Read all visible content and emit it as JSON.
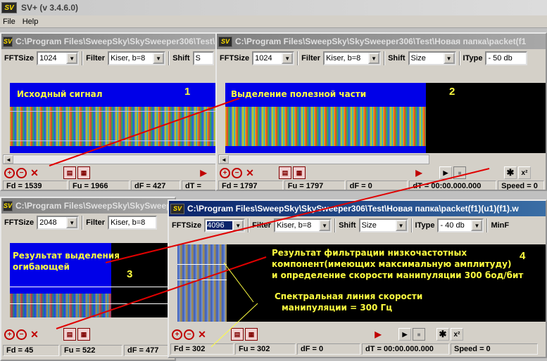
{
  "app": {
    "title": "SV+  (v 3.4.6.0)",
    "logo": "SV"
  },
  "menu": [
    "File",
    "Help"
  ],
  "windows": [
    {
      "title": "C:\\Program Files\\SweepSky\\SkySweeper306\\Test\\Новая папка\\packet(f1)",
      "fftsize_label": "FFTSize",
      "fftsize": "1024",
      "filter_label": "Filter",
      "filter": "Kiser, b=8",
      "shift_label": "Shift",
      "shift": "S",
      "annotation": "Исходный сигнал",
      "number": "1",
      "status": [
        "Fd = 1539",
        "Fu = 1966",
        "dF = 427",
        "dT ="
      ]
    },
    {
      "title": "C:\\Program Files\\SweepSky\\SkySweeper306\\Test\\Новая папка\\packet(f1",
      "fftsize_label": "FFTSize",
      "fftsize": "1024",
      "filter_label": "Filter",
      "filter": "Kiser, b=8",
      "shift_label": "Shift",
      "shift": "Size",
      "itype_label": "IType",
      "itype": "- 50 db",
      "annotation": "Выделение полезной части",
      "number": "2",
      "status": [
        "Fd = 1797",
        "Fu = 1797",
        "dF = 0",
        "dT = 00:00.000.000",
        "Speed = 0"
      ]
    },
    {
      "title": "C:\\Program Files\\SweepSky\\SkySweeper306",
      "fftsize_label": "FFTSize",
      "fftsize": "2048",
      "filter_label": "Filter",
      "filter": "Kiser, b=8",
      "annotation_lines": [
        "Результат выделения",
        "огибающей"
      ],
      "number": "3",
      "status": [
        "Fd = 45",
        "Fu = 522",
        "dF = 477"
      ]
    },
    {
      "title": "C:\\Program Files\\SweepSky\\SkySweeper306\\Test\\Новая папка\\packet(f1)(u1)(f1).w",
      "fftsize_label": "FFTSize",
      "fftsize": "4096",
      "filter_label": "Filter",
      "filter": "Kiser, b=8",
      "shift_label": "Shift",
      "shift": "Size",
      "itype_label": "IType",
      "itype": "- 40 db",
      "minf_label": "MinF",
      "annotation_lines": [
        "Результат фильтрации низкочастотных",
        "компонент(имеющих максимальную амплитуду)",
        "и определение скорости манипуляции 300 бод/бит"
      ],
      "annotation2_lines": [
        "Спектральная линия скорости",
        "манипуляции = 300 Гц"
      ],
      "number": "4",
      "status": [
        "Fd = 302",
        "Fu = 302",
        "dF = 0",
        "dT = 00:00.000.000",
        "Speed = 0"
      ]
    }
  ],
  "colors": {
    "annotation": "#ffff40",
    "arrow": "#e00000",
    "spectrum_bg": "#0000e8"
  }
}
